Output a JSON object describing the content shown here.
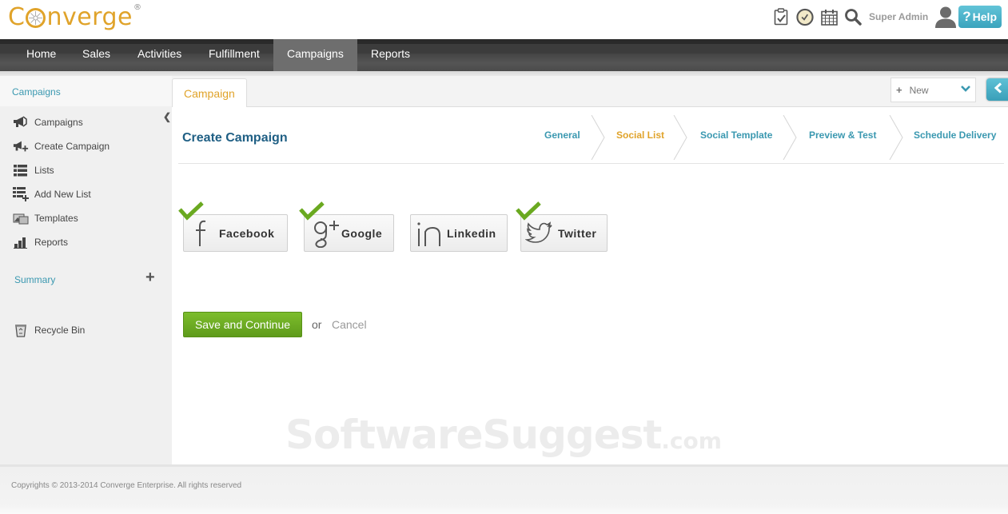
{
  "app": {
    "logo_text_pre": "C",
    "logo_text_post": "nverge",
    "logo_reg": "®"
  },
  "header": {
    "icons": [
      "clipboard-check-icon",
      "clock-icon",
      "calendar-icon",
      "search-icon"
    ],
    "user_name": "Super Admin",
    "help_label": "Help",
    "help_glyph": "?"
  },
  "nav": {
    "items": [
      {
        "label": "Home",
        "active": false
      },
      {
        "label": "Sales",
        "active": false
      },
      {
        "label": "Activities",
        "active": false
      },
      {
        "label": "Fulfillment",
        "active": false
      },
      {
        "label": "Campaigns",
        "active": true
      },
      {
        "label": "Reports",
        "active": false
      }
    ]
  },
  "sidebar": {
    "heading": "Campaigns",
    "items": [
      {
        "label": "Campaigns",
        "icon": "megaphone-icon"
      },
      {
        "label": "Create Campaign",
        "icon": "megaphone-add-icon"
      },
      {
        "label": "Lists",
        "icon": "list-icon"
      },
      {
        "label": "Add New List",
        "icon": "list-add-icon"
      },
      {
        "label": "Templates",
        "icon": "templates-icon"
      },
      {
        "label": "Reports",
        "icon": "bar-chart-icon"
      }
    ],
    "summary_label": "Summary",
    "summary_add_glyph": "+",
    "recycle_label": "Recycle Bin"
  },
  "tabs": {
    "active_tab": "Campaign",
    "new_select": {
      "label": "New",
      "plus": "+"
    }
  },
  "main": {
    "title": "Create Campaign",
    "steps": [
      {
        "label": "General",
        "active": false
      },
      {
        "label": "Social List",
        "active": true
      },
      {
        "label": "Social Template",
        "active": false
      },
      {
        "label": "Preview & Test",
        "active": false
      },
      {
        "label": "Schedule Delivery",
        "active": false
      }
    ],
    "social_networks": [
      {
        "label": "Facebook",
        "selected": true
      },
      {
        "label": "Google",
        "selected": true
      },
      {
        "label": "Linkedin",
        "selected": false
      },
      {
        "label": "Twitter",
        "selected": true
      }
    ],
    "save_label": "Save and Continue",
    "or_text": "or",
    "cancel_label": "Cancel"
  },
  "watermark": {
    "main": "SoftwareSuggest",
    "suffix": ".com"
  },
  "footer": {
    "copyright": "Copyrights © 2013-2014 Converge Enterprise. All rights reserved"
  },
  "colors": {
    "brand": "#e0a32a",
    "link": "#3a98b0",
    "title": "#1f5f84",
    "primary_button": "#6aa920",
    "check": "#6aa920",
    "help": "#4bb3ca"
  }
}
